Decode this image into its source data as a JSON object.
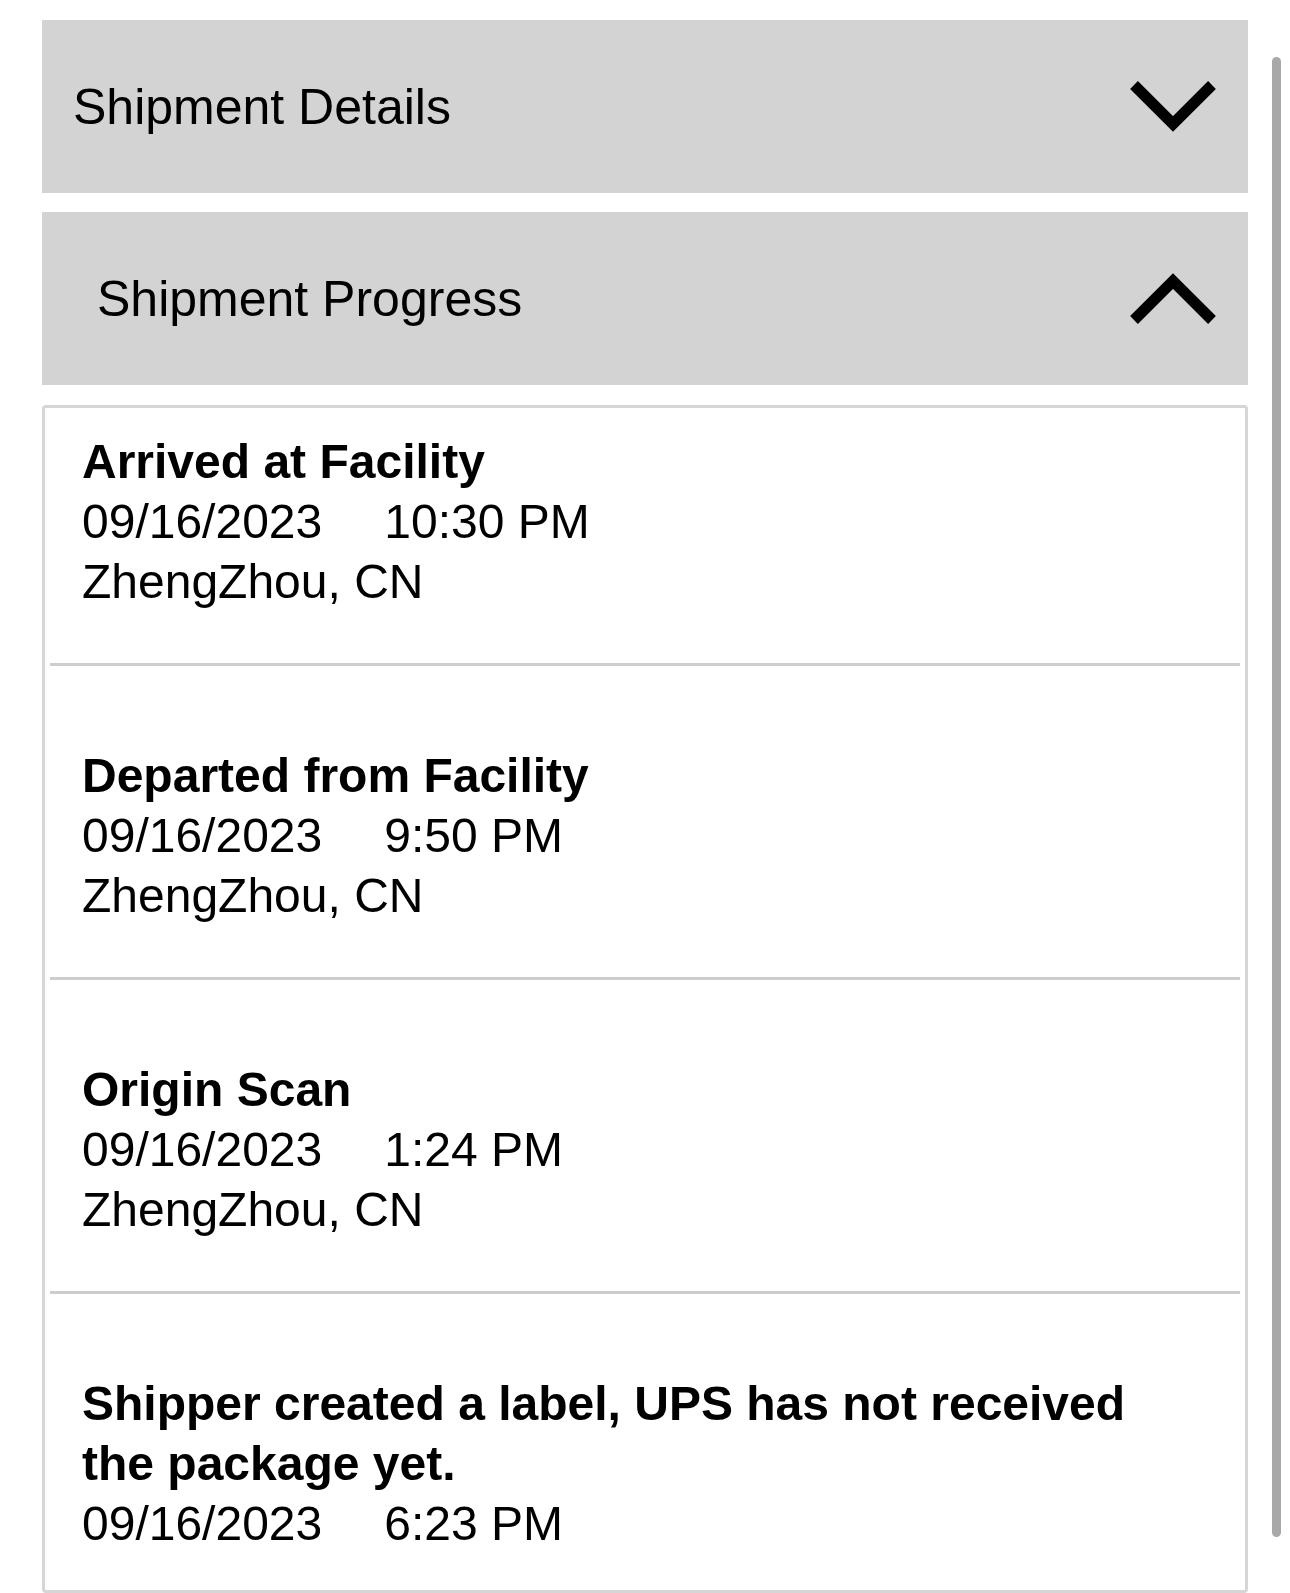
{
  "sections": [
    {
      "title": "Shipment Details",
      "expanded": false
    },
    {
      "title": "Shipment Progress",
      "expanded": true,
      "events": [
        {
          "status": "Arrived at Facility",
          "date": "09/16/2023",
          "time": "10:30 PM",
          "location": "ZhengZhou, CN"
        },
        {
          "status": "Departed from Facility",
          "date": "09/16/2023",
          "time": "9:50 PM",
          "location": "ZhengZhou, CN"
        },
        {
          "status": "Origin Scan",
          "date": "09/16/2023",
          "time": "1:24 PM",
          "location": "ZhengZhou, CN"
        },
        {
          "status": "Shipper created a label, UPS has not received the package yet.",
          "date": "09/16/2023",
          "time": "6:23 PM"
        }
      ]
    }
  ]
}
